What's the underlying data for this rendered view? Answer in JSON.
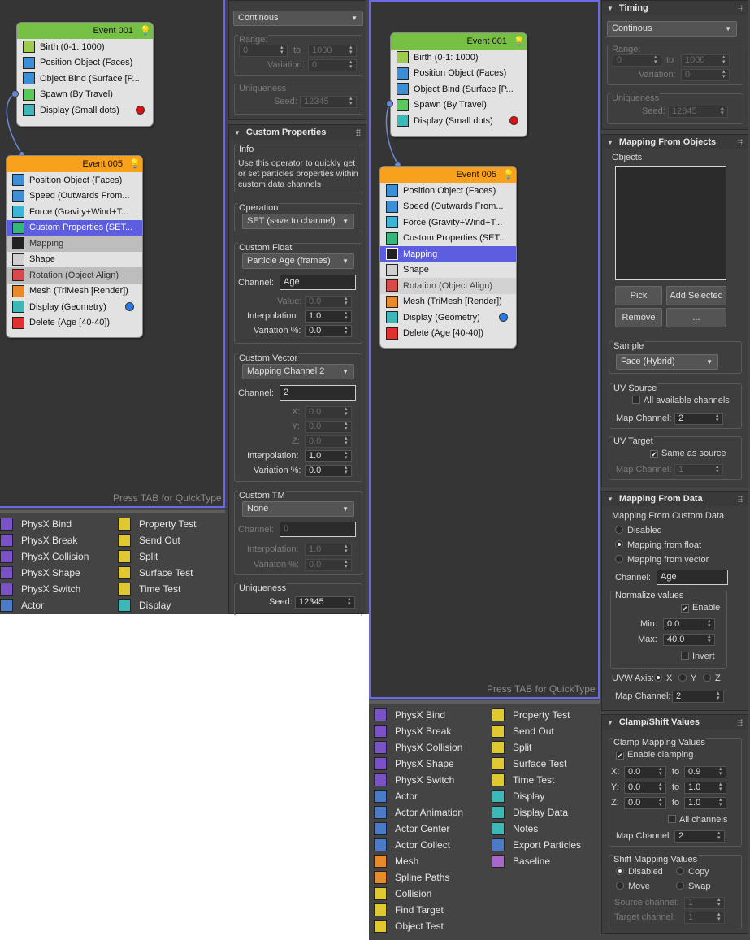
{
  "left": {
    "event1": {
      "title": "Event 001",
      "rows": [
        "Birth (0-1: 1000)",
        "Position Object (Faces)",
        "Object Bind (Surface [P...",
        "Spawn (By Travel)",
        "Display (Small dots)"
      ]
    },
    "event5": {
      "title": "Event 005",
      "rows": [
        "Position Object (Faces)",
        "Speed (Outwards From...",
        "Force (Gravity+Wind+T...",
        "Custom Properties (SET...",
        "Mapping",
        "Shape",
        "Rotation (Object Align)",
        "Mesh (TriMesh [Render])",
        "Display (Geometry)",
        "Delete (Age [40-40])"
      ]
    },
    "tab_hint": "Press TAB for QuickType",
    "depot_col1": [
      "PhysX Bind",
      "PhysX Break",
      "PhysX Collision",
      "PhysX Shape",
      "PhysX Switch",
      "Actor"
    ],
    "depot_col2": [
      "Property Test",
      "Send Out",
      "Split",
      "Surface Test",
      "Time Test",
      "Display"
    ]
  },
  "mid": {
    "timing_dd": "Continous",
    "range": {
      "title": "Range:",
      "from": "0",
      "to_label": "to",
      "to": "1000",
      "variation_label": "Variation:",
      "variation": "0"
    },
    "uniqueness": {
      "title": "Uniqueness",
      "seed_label": "Seed:",
      "seed": "12345"
    },
    "custom_props_title": "Custom Properties",
    "info": {
      "title": "Info",
      "text": "Use this operator to quickly get or set particles properties within custom data channels"
    },
    "operation": {
      "title": "Operation",
      "value": "SET (save to channel)"
    },
    "custom_float": {
      "title": "Custom Float",
      "dd": "Particle Age (frames)",
      "channel_label": "Channel:",
      "channel": "Age",
      "value_label": "Value:",
      "value": "0.0",
      "interp_label": "Interpolation:",
      "interp": "1.0",
      "var_label": "Variation %:",
      "var": "0.0"
    },
    "custom_vector": {
      "title": "Custom Vector",
      "dd": "Mapping Channel 2",
      "channel_label": "Channel:",
      "channel": "2",
      "x_label": "X:",
      "x": "0.0",
      "y_label": "Y:",
      "y": "0.0",
      "z_label": "Z:",
      "z": "0.0",
      "interp_label": "Interpolation:",
      "interp": "1.0",
      "var_label": "Variation %:",
      "var": "0.0"
    },
    "custom_tm": {
      "title": "Custom TM",
      "dd": "None",
      "channel_label": "Channel:",
      "channel": "0",
      "interp_label": "Interpolation:",
      "interp": "1.0",
      "var_label": "Variaton %:",
      "var": "0.0"
    },
    "uniqueness2": {
      "title": "Uniqueness",
      "seed_label": "Seed:",
      "seed": "12345"
    }
  },
  "right": {
    "event1": {
      "title": "Event 001",
      "rows": [
        "Birth (0-1: 1000)",
        "Position Object (Faces)",
        "Object Bind (Surface [P...",
        "Spawn (By Travel)",
        "Display (Small dots)"
      ]
    },
    "event5": {
      "title": "Event 005",
      "rows": [
        "Position Object (Faces)",
        "Speed (Outwards From...",
        "Force (Gravity+Wind+T...",
        "Custom Properties (SET...",
        "Mapping",
        "Shape",
        "Rotation (Object Align)",
        "Mesh (TriMesh [Render])",
        "Display (Geometry)",
        "Delete (Age [40-40])"
      ]
    },
    "tab_hint": "Press TAB for QuickType",
    "depot_col1": [
      "PhysX Bind",
      "PhysX Break",
      "PhysX Collision",
      "PhysX Shape",
      "PhysX Switch",
      "Actor",
      "Actor Animation",
      "Actor Center",
      "Actor Collect",
      "Mesh",
      "Spline Paths",
      "Collision",
      "Find Target",
      "Object Test"
    ],
    "depot_col2": [
      "Property Test",
      "Send Out",
      "Split",
      "Surface Test",
      "Time Test",
      "Display",
      "Display Data",
      "Notes",
      "Export Particles",
      "Baseline"
    ]
  },
  "props": {
    "timing_title": "Timing",
    "timing_dd": "Continous",
    "range": {
      "title": "Range:",
      "from": "0",
      "to_label": "to",
      "to": "1000",
      "variation_label": "Variation:",
      "variation": "0"
    },
    "uniqueness": {
      "title": "Uniqueness",
      "seed_label": "Seed:",
      "seed": "12345"
    },
    "mfo_title": "Mapping From Objects",
    "objects_label": "Objects",
    "pick": "Pick",
    "add_selected": "Add Selected",
    "remove": "Remove",
    "more": "...",
    "sample": {
      "title": "Sample",
      "value": "Face (Hybrid)"
    },
    "uv_source": {
      "title": "UV Source",
      "all_label": "All available channels",
      "map_label": "Map Channel:",
      "map": "2"
    },
    "uv_target": {
      "title": "UV Target",
      "same_label": "Same as source",
      "map_label": "Map Channel:",
      "map": "1"
    },
    "mfd_title": "Mapping From Data",
    "mfcd": {
      "title": "Mapping From Custom Data",
      "opt1": "Disabled",
      "opt2": "Mapping from float",
      "opt3": "Mapping from vector",
      "channel_label": "Channel:",
      "channel": "Age"
    },
    "normalize": {
      "title": "Normalize values",
      "enable": "Enable",
      "min_label": "Min:",
      "min": "0.0",
      "max_label": "Max:",
      "max": "40.0",
      "invert": "Invert"
    },
    "uvw": {
      "label": "UVW Axis:",
      "x": "X",
      "y": "Y",
      "z": "Z",
      "map_label": "Map Channel:",
      "map": "2"
    },
    "clamp_title": "Clamp/Shift Values",
    "clamp": {
      "title": "Clamp Mapping Values",
      "enable": "Enable clamping",
      "x_label": "X:",
      "x_min": "0.0",
      "x_max": "0.9",
      "y_label": "Y:",
      "y_min": "0.0",
      "y_max": "1.0",
      "z_label": "Z:",
      "z_min": "0.0",
      "z_max": "1.0",
      "to": "to",
      "all": "All channels",
      "map_label": "Map Channel:",
      "map": "2"
    },
    "shift": {
      "title": "Shift Mapping Values",
      "disabled": "Disabled",
      "copy": "Copy",
      "move": "Move",
      "swap": "Swap",
      "source_label": "Source channel:",
      "source": "1",
      "target_label": "Target channel:",
      "target": "1"
    }
  }
}
